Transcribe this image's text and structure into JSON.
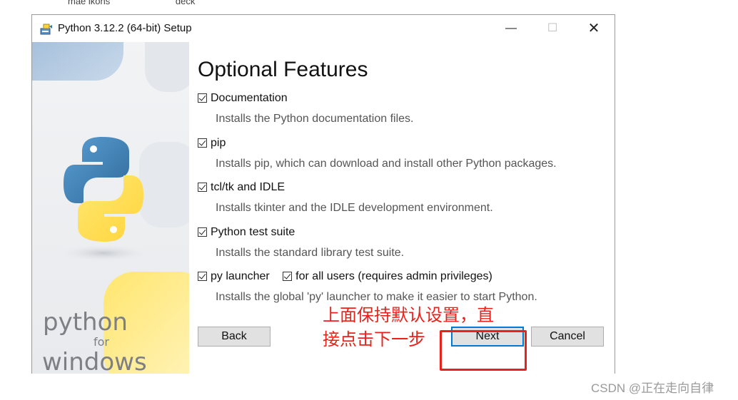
{
  "top_cropped_text": [
    "mae ikons",
    "deck"
  ],
  "window": {
    "title": "Python 3.12.2 (64-bit) Setup",
    "icon": "python-installer-icon",
    "controls": {
      "minimize": "—",
      "maximize": "☐",
      "close": "✕"
    }
  },
  "sidebar": {
    "brand_python": "python",
    "brand_for": "for",
    "brand_windows": "windows"
  },
  "page": {
    "heading": "Optional Features",
    "features": [
      {
        "label": "Documentation",
        "checked": true,
        "description": "Installs the Python documentation files."
      },
      {
        "label": "pip",
        "checked": true,
        "description": "Installs pip, which can download and install other Python packages."
      },
      {
        "label": "tcl/tk and IDLE",
        "checked": true,
        "description": "Installs tkinter and the IDLE development environment."
      },
      {
        "label": "Python test suite",
        "checked": true,
        "description": "Installs the standard library test suite."
      },
      {
        "label": "py launcher",
        "checked": true,
        "description": "Installs the global 'py' launcher to make it easier to start Python."
      }
    ],
    "for_all_users": {
      "label": "for all users (requires admin privileges)",
      "checked": true
    }
  },
  "buttons": {
    "back": "Back",
    "next": "Next",
    "cancel": "Cancel"
  },
  "annotation": {
    "line1": "上面保持默认设置，直",
    "line2": "接点击下一步",
    "color": "#e8211a"
  },
  "watermark": "CSDN @正在走向自律",
  "colors": {
    "accent_blue": "#0078d7",
    "python_blue": "#3776ab",
    "python_yellow": "#ffd43b"
  }
}
